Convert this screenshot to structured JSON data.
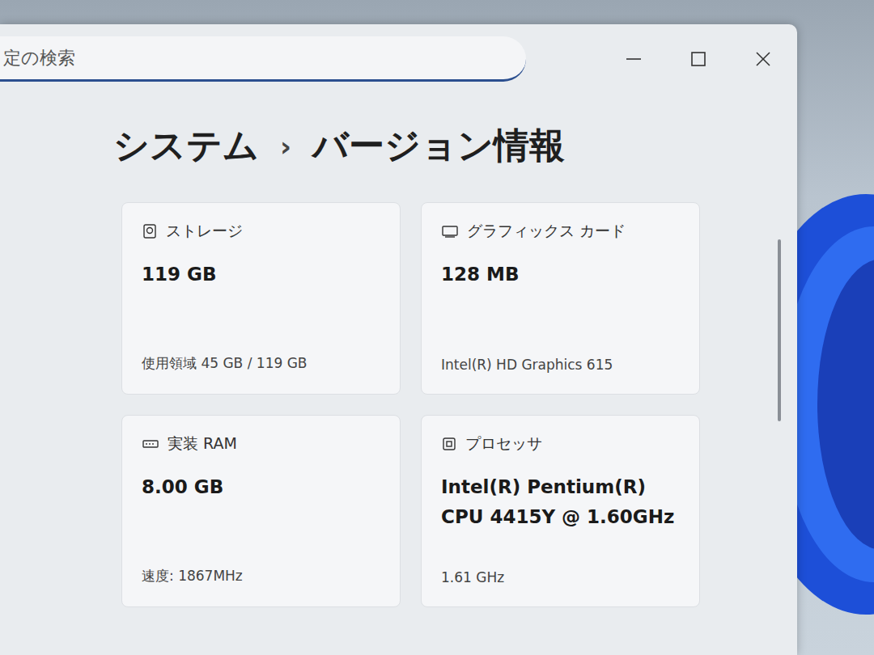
{
  "window": {
    "search": {
      "placeholder": "定の検索"
    }
  },
  "breadcrumb": {
    "items": [
      {
        "label": "システム",
        "selected": false
      },
      {
        "label": "バージョン情報",
        "selected": true
      }
    ],
    "separator": "›"
  },
  "cards": [
    {
      "kind": "storage",
      "label": "ストレージ",
      "value": "119 GB",
      "detail": "使用領域 45 GB / 119 GB"
    },
    {
      "kind": "graphics",
      "label": "グラフィックス カード",
      "value": "128 MB",
      "detail": "Intel(R) HD Graphics 615"
    },
    {
      "kind": "ram",
      "label": "実装 RAM",
      "value": "8.00 GB",
      "detail": "速度: 1867MHz"
    },
    {
      "kind": "processor",
      "label": "プロセッサ",
      "value": "Intel(R) Pentium(R) CPU 4415Y @ 1.60GHz",
      "detail": "1.61 GHz"
    }
  ]
}
